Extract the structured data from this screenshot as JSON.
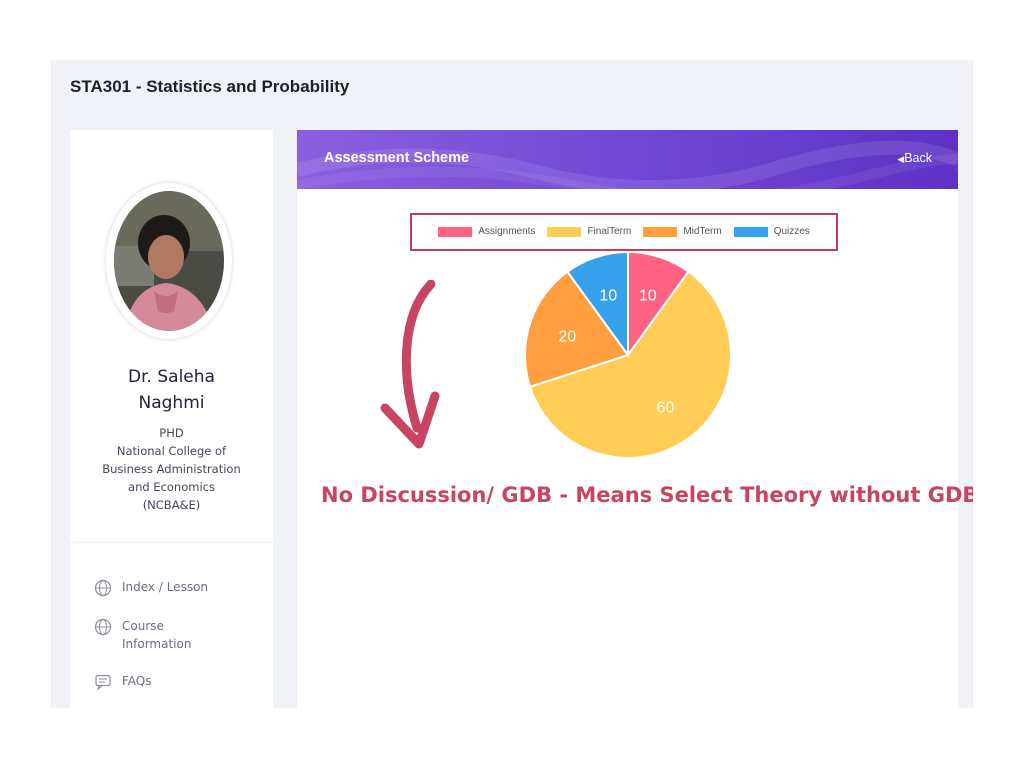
{
  "course": {
    "title": "STA301 - Statistics and Probability"
  },
  "professor": {
    "name": "Dr. Saleha Naghmi",
    "degree": "PHD",
    "institution_line1": "National College of",
    "institution_line2": "Business Administration",
    "institution_line3": "and Economics",
    "institution_line4": "(NCBA&E)"
  },
  "sidebar": {
    "items": [
      {
        "label": "Index / Lesson",
        "icon": "globe-icon"
      },
      {
        "label": "Course Information",
        "icon": "globe-icon"
      },
      {
        "label": "FAQs",
        "icon": "chat-icon"
      }
    ]
  },
  "panel": {
    "title": "Assessment Scheme",
    "back_label": "Back"
  },
  "annotation": {
    "note": "No Discussion/ GDB - Means Select Theory without GDB",
    "color": "#c84461"
  },
  "colors": {
    "header_gradient_start": "#8a5fe0",
    "header_gradient_end": "#5d32c4",
    "highlight": "#c43d5a"
  },
  "chart_data": {
    "type": "pie",
    "legend_position": "top",
    "series": [
      {
        "name": "Assignments",
        "value": 10,
        "color": "#ff6384"
      },
      {
        "name": "FinalTerm",
        "value": 60,
        "color": "#ffcd56"
      },
      {
        "name": "MidTerm",
        "value": 20,
        "color": "#ff9f40"
      },
      {
        "name": "Quizzes",
        "value": 10,
        "color": "#36a2eb"
      }
    ]
  }
}
